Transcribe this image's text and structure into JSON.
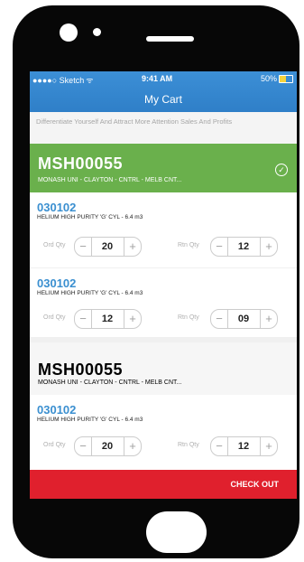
{
  "status_bar": {
    "carrier": "●●●●○ Sketch",
    "time": "9:41 AM",
    "battery": "50%",
    "battery_level": 0.5
  },
  "nav": {
    "title": "My Cart"
  },
  "promo": {
    "text": "Differentiate Yourself And Attract More Attention Sales And Profits"
  },
  "stores": [
    {
      "code": "MSH00055",
      "location": "MONASH UNI - CLAYTON - CNTRL - MELB CNT...",
      "selected": true,
      "items": [
        {
          "code": "030102",
          "description": "HELIUM HIGH PURITY 'G' CYL - 6.4 m3",
          "ord_label": "Ord Qty",
          "ord_qty": "20",
          "rtn_label": "Rtn Qty",
          "rtn_qty": "12"
        },
        {
          "code": "030102",
          "description": "HELIUM HIGH PURITY 'G' CYL - 6.4 m3",
          "ord_label": "Ord Qty",
          "ord_qty": "12",
          "rtn_label": "Rtn Qty",
          "rtn_qty": "09"
        }
      ]
    },
    {
      "code": "MSH00055",
      "location": "MONASH UNI - CLAYTON - CNTRL - MELB CNT...",
      "selected": false,
      "items": [
        {
          "code": "030102",
          "description": "HELIUM HIGH PURITY 'G' CYL - 6.4 m3",
          "ord_label": "Ord Qty",
          "ord_qty": "20",
          "rtn_label": "Rtn Qty",
          "rtn_qty": "12"
        }
      ]
    }
  ],
  "stepper": {
    "minus": "−",
    "plus": "+"
  },
  "checkout": {
    "label": "CHECK OUT"
  },
  "colors": {
    "nav": "#3c8fd6",
    "selected_store": "#6ab04c",
    "item_code": "#3a8fd0",
    "checkout": "#e0202d"
  }
}
